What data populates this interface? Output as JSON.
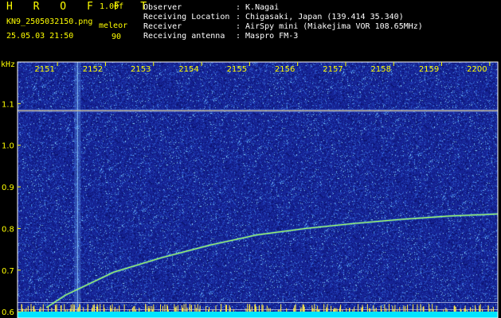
{
  "header": {
    "app_name": "H R O F F T",
    "version": "1.00f",
    "file_name": "KN9_2505032150.png",
    "mode_label": "meleor",
    "timestamp": "25.05.03 21:50",
    "mode_value": "90",
    "fields": [
      {
        "label": "Observer",
        "value": ": K.Nagai"
      },
      {
        "label": "Receiving Location",
        "value": ": Chigasaki, Japan (139.414 35.340)"
      },
      {
        "label": "Receiver",
        "value": ": AirSpy mini (Miakejima VOR 108.65MHz)"
      },
      {
        "label": "Receiving antenna",
        "value": ": Maspro FM-3"
      }
    ]
  },
  "chart_data": {
    "type": "heatmap",
    "ylabel": "kHz",
    "x_ticks": [
      "2151",
      "2152",
      "2153",
      "2154",
      "2155",
      "2156",
      "2157",
      "2158",
      "2159",
      "2200"
    ],
    "y_ticks": [
      "1.1",
      "1.0",
      "0.9",
      "0.8",
      "0.7",
      "0.6"
    ],
    "y_tick_values": [
      1.1,
      1.0,
      0.9,
      0.8,
      0.7,
      0.6
    ],
    "ylim": [
      0.585,
      1.2
    ],
    "time_range_minutes": [
      0,
      10
    ],
    "carrier_khz": 1.083,
    "marker_lines_khz": [
      0.622,
      0.605
    ],
    "meteor_echo_minute": 1.25,
    "trace": {
      "description_points_minutes_khz": [
        [
          0.6,
          0.61
        ],
        [
          1.0,
          0.64
        ],
        [
          2.0,
          0.695
        ],
        [
          3.0,
          0.73
        ],
        [
          4.0,
          0.76
        ],
        [
          5.0,
          0.785
        ],
        [
          6.0,
          0.8
        ],
        [
          7.0,
          0.812
        ],
        [
          8.0,
          0.822
        ],
        [
          9.0,
          0.83
        ],
        [
          10.0,
          0.835
        ]
      ]
    },
    "colors": {
      "background": "#1a2b9c",
      "noise_bright": "#7fd4ff",
      "trace": "#a8ff60",
      "carrier": "#ffe07a",
      "bottom_strip": "#00e5ff",
      "tick_text": "#ffff00"
    }
  }
}
